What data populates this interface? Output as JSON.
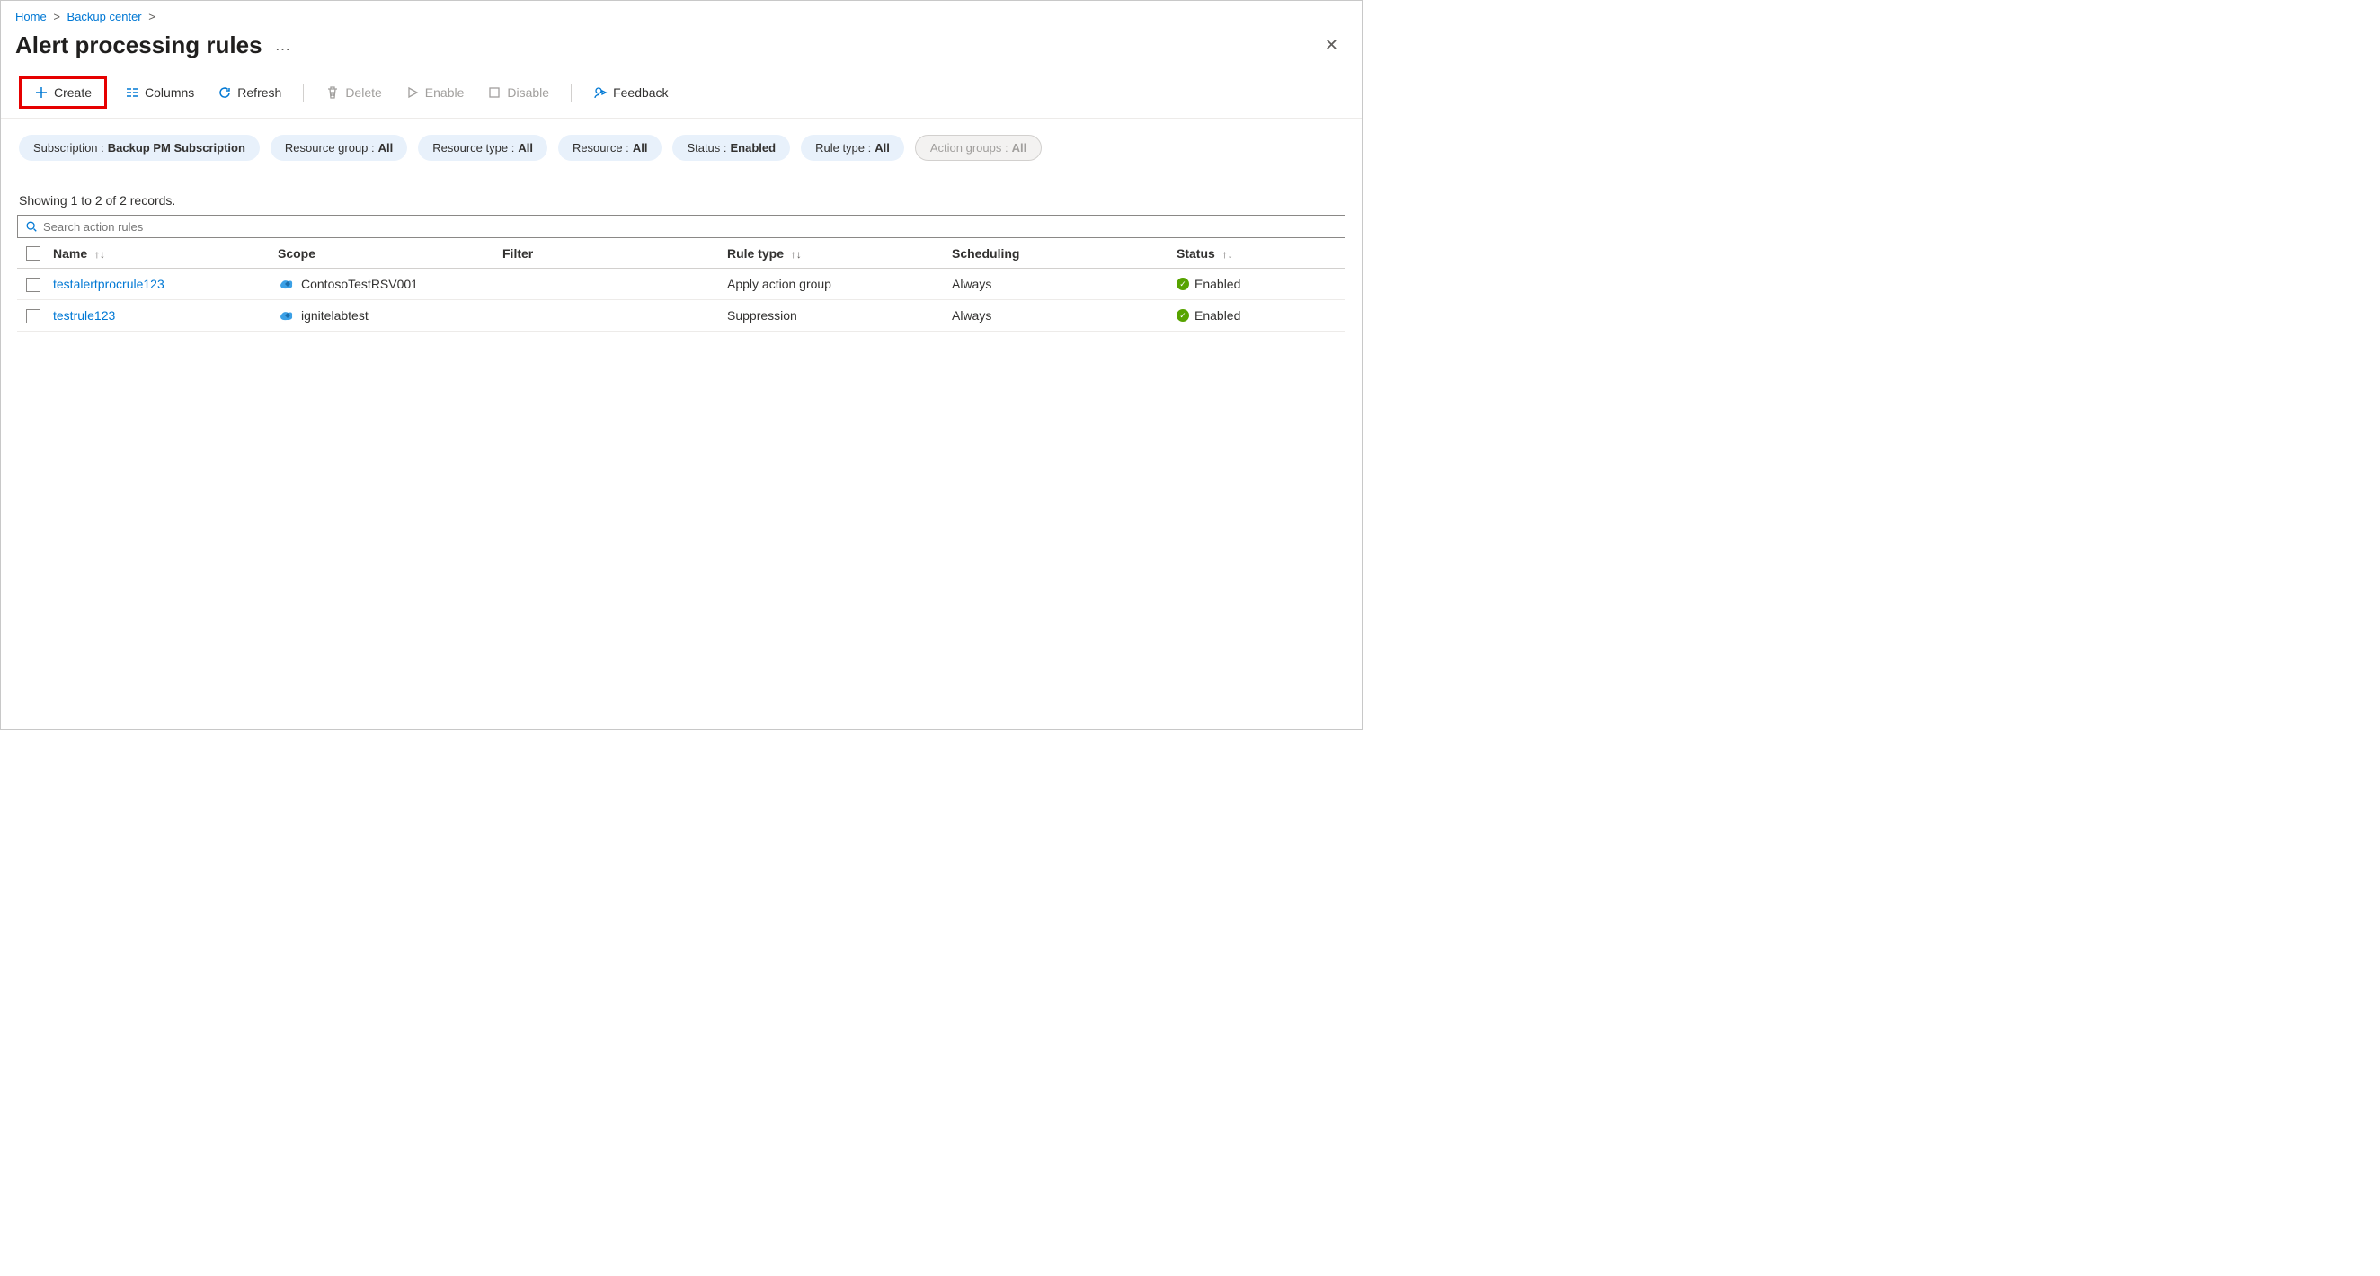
{
  "breadcrumb": {
    "home": "Home",
    "backup_center": "Backup center"
  },
  "page": {
    "title": "Alert processing rules",
    "more": "…"
  },
  "toolbar": {
    "create": "Create",
    "columns": "Columns",
    "refresh": "Refresh",
    "delete": "Delete",
    "enable": "Enable",
    "disable": "Disable",
    "feedback": "Feedback"
  },
  "filters": [
    {
      "label": "Subscription :",
      "value": "Backup PM Subscription",
      "disabled": false
    },
    {
      "label": "Resource group :",
      "value": "All",
      "disabled": false
    },
    {
      "label": "Resource type :",
      "value": "All",
      "disabled": false
    },
    {
      "label": "Resource :",
      "value": "All",
      "disabled": false
    },
    {
      "label": "Status :",
      "value": "Enabled",
      "disabled": false
    },
    {
      "label": "Rule type :",
      "value": "All",
      "disabled": false
    },
    {
      "label": "Action groups :",
      "value": "All",
      "disabled": true
    }
  ],
  "records_info": "Showing 1 to 2 of 2 records.",
  "search": {
    "placeholder": "Search action rules"
  },
  "columns": {
    "name": "Name",
    "scope": "Scope",
    "filter": "Filter",
    "rule_type": "Rule type",
    "scheduling": "Scheduling",
    "status": "Status"
  },
  "sort_glyph": "↑↓",
  "rows": [
    {
      "name": "testalertprocrule123",
      "scope": "ContosoTestRSV001",
      "filter": "",
      "rule_type": "Apply action group",
      "scheduling": "Always",
      "status": "Enabled"
    },
    {
      "name": "testrule123",
      "scope": "ignitelabtest",
      "filter": "",
      "rule_type": "Suppression",
      "scheduling": "Always",
      "status": "Enabled"
    }
  ]
}
